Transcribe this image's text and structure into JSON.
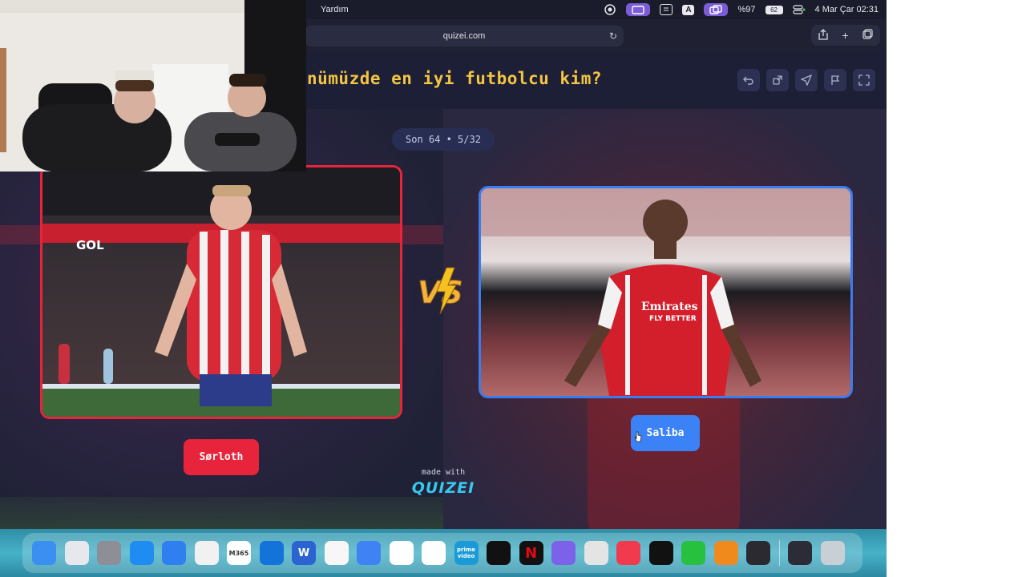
{
  "menubar": {
    "menu_help": "Yardım",
    "battery_percent": "%97",
    "battery_icon_label": "62",
    "input_source": "A",
    "datetime": "4 Mar Çar  02:31"
  },
  "browser": {
    "url": "quizei.com",
    "reload_icon": "reload-icon",
    "share_icon": "share-icon",
    "new_tab_icon": "plus-icon",
    "tabs_icon": "tabs-icon"
  },
  "quiz": {
    "question": "nümüzde en iyi futbolcu kim?",
    "round": "Son 64 • 5/32",
    "tools": [
      "undo-icon",
      "share-icon",
      "send-icon",
      "flag-icon",
      "fullscreen-icon"
    ],
    "left": {
      "name": "Sørloth",
      "banner_text": "GOL",
      "color": "#e8243c"
    },
    "right": {
      "name": "Saliba",
      "shirt_sponsor": "Emirates",
      "shirt_sponsor_2": "FLY BETTER",
      "color": "#3b82f6"
    },
    "vs_label": "VS",
    "made_with": "made with",
    "brand": "QUIZEI"
  },
  "dock": {
    "apps": [
      {
        "name": "finder",
        "color": "#3a8ff0",
        "label": ""
      },
      {
        "name": "launchpad",
        "color": "#e7e7ee",
        "label": ""
      },
      {
        "name": "system-settings",
        "color": "#8e8e96",
        "label": ""
      },
      {
        "name": "app-store",
        "color": "#1e8cf0",
        "label": ""
      },
      {
        "name": "safari",
        "color": "#2f7ff0",
        "label": ""
      },
      {
        "name": "chrome",
        "color": "#f1f1f1",
        "label": ""
      },
      {
        "name": "m365",
        "color": "#ffffff",
        "label": "M365"
      },
      {
        "name": "outlook",
        "color": "#1473d8",
        "label": ""
      },
      {
        "name": "word",
        "color": "#2b64d0",
        "label": "W"
      },
      {
        "name": "freeform",
        "color": "#f7f7f7",
        "label": ""
      },
      {
        "name": "translate",
        "color": "#3e82f4",
        "label": ""
      },
      {
        "name": "gemini",
        "color": "#ffffff",
        "label": ""
      },
      {
        "name": "chatgpt",
        "color": "#ffffff",
        "label": ""
      },
      {
        "name": "prime-video",
        "color": "#1a9ad6",
        "label": "prime video"
      },
      {
        "name": "obs-record",
        "color": "#111111",
        "label": ""
      },
      {
        "name": "netflix",
        "color": "#111111",
        "label": "N"
      },
      {
        "name": "infuse",
        "color": "#7c62e8",
        "label": ""
      },
      {
        "name": "youtube",
        "color": "#e4e4e4",
        "label": ""
      },
      {
        "name": "music",
        "color": "#f23a4f",
        "label": ""
      },
      {
        "name": "spotify",
        "color": "#111111",
        "label": ""
      },
      {
        "name": "whatsapp",
        "color": "#28c13f",
        "label": ""
      },
      {
        "name": "fl-studio",
        "color": "#f08a1c",
        "label": ""
      },
      {
        "name": "obs",
        "color": "#2a2a30",
        "label": ""
      },
      {
        "name": "recent-window",
        "color": "#2c2c36",
        "label": ""
      },
      {
        "name": "trash",
        "color": "#c8d0d6",
        "label": ""
      }
    ]
  }
}
